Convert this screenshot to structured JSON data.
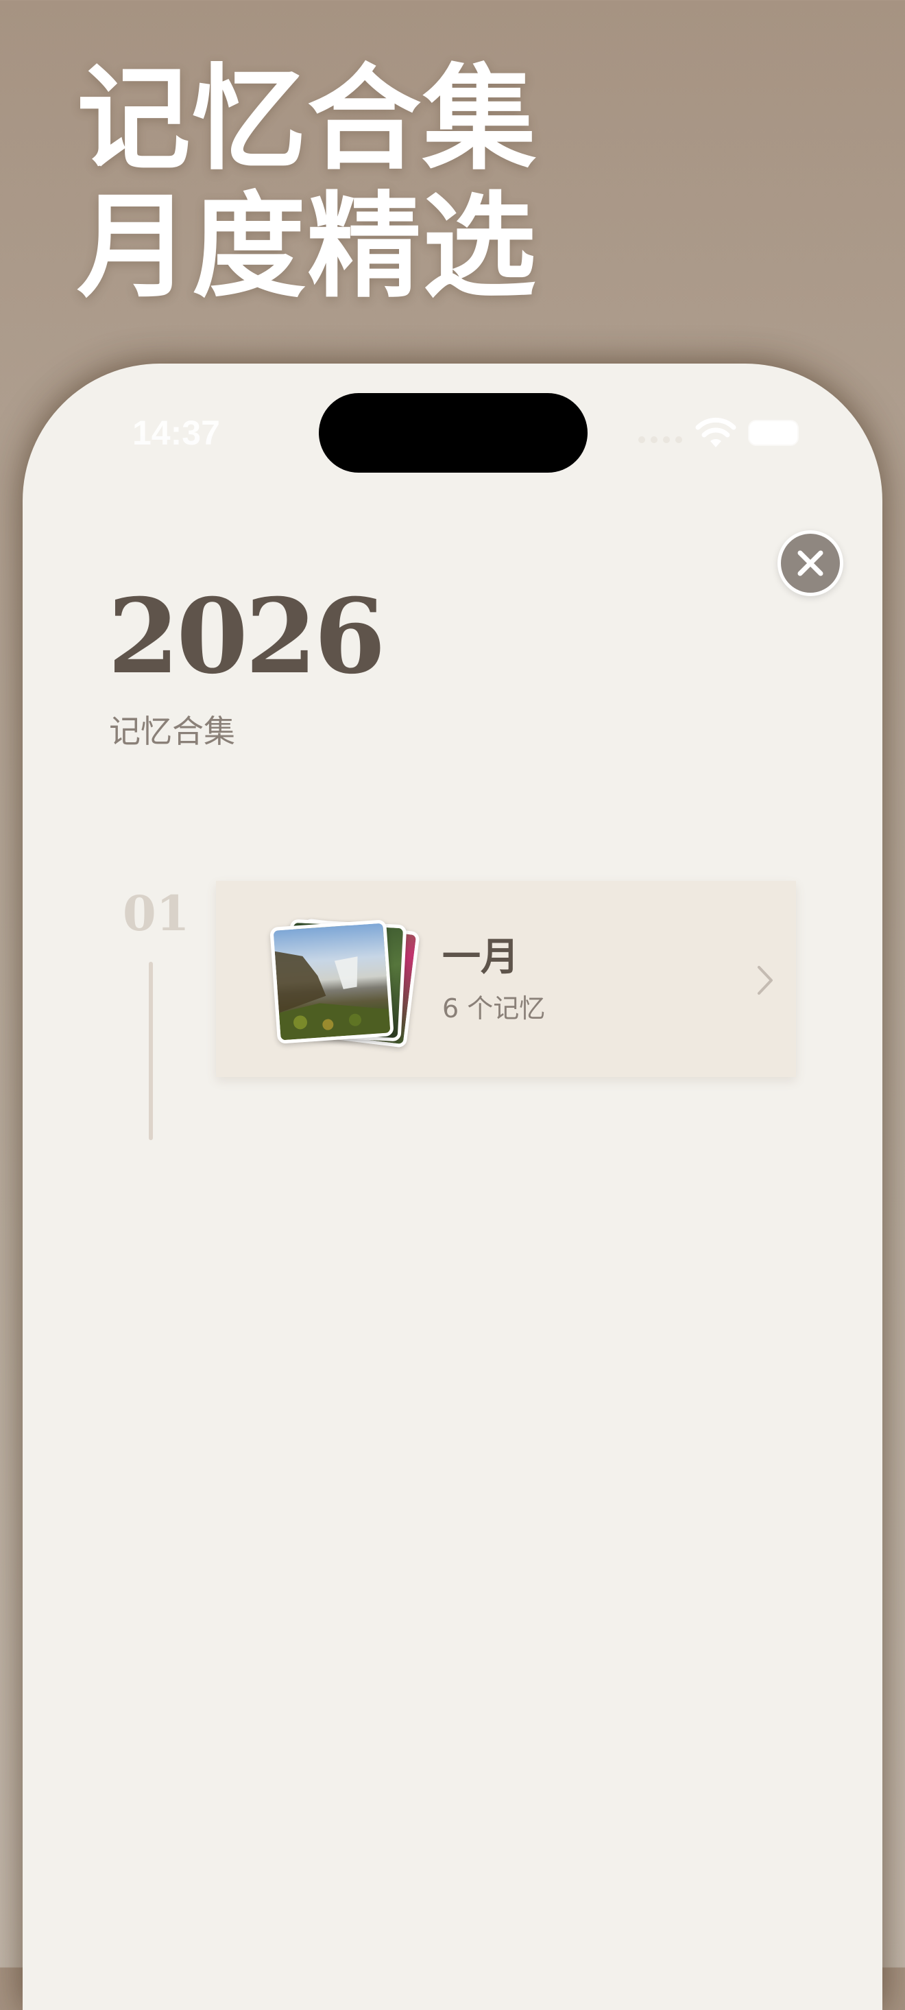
{
  "headline": {
    "line1": "记忆合集",
    "line2": "月度精选"
  },
  "status_bar": {
    "time": "14:37"
  },
  "header": {
    "year": "2026",
    "subtitle": "记忆合集"
  },
  "timeline": {
    "items": [
      {
        "index": "01",
        "month": "一月",
        "count_label": "6 个记忆"
      }
    ]
  },
  "icons": {
    "close": "close-icon",
    "chevron": "chevron-right-icon",
    "wifi": "wifi-icon",
    "battery": "battery-icon",
    "signal": "cellular-signal-icon"
  },
  "colors": {
    "background": "#b1a293",
    "screen": "#f3f1ec",
    "card": "#efe9e0",
    "title_text": "#5f544b",
    "secondary_text": "#8a8078",
    "close_button": "#8f8780"
  }
}
